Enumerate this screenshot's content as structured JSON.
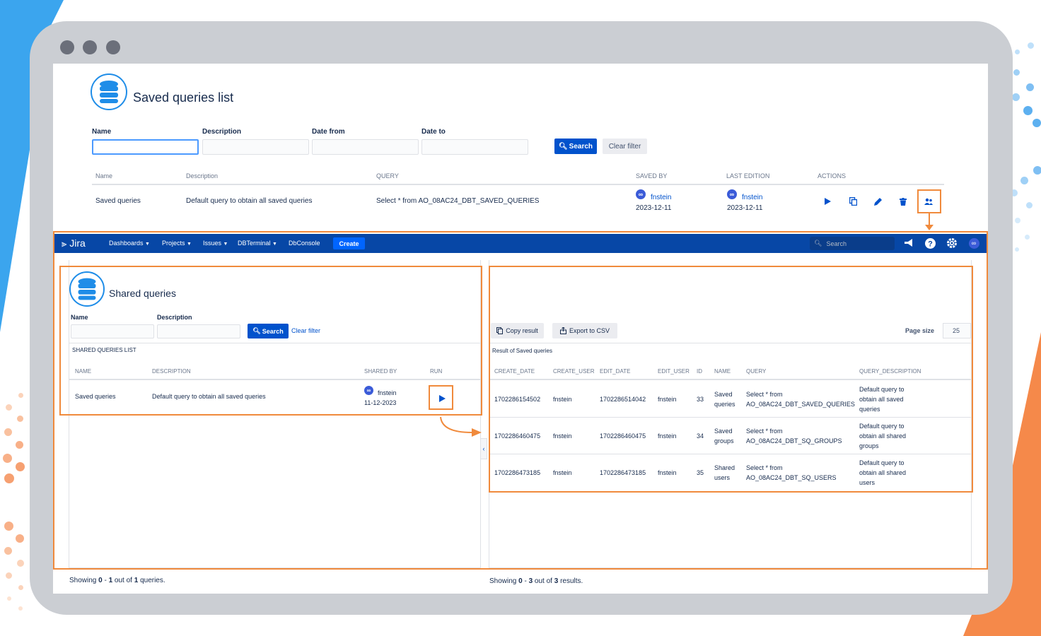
{
  "window": {
    "buttons": [
      "close",
      "minimize",
      "maximize"
    ]
  },
  "saved_list": {
    "title": "Saved queries list",
    "filters": {
      "name_label": "Name",
      "description_label": "Description",
      "date_from_label": "Date from",
      "date_to_label": "Date to",
      "search_button": "Search",
      "clear_button": "Clear filter"
    },
    "columns": [
      "Name",
      "Description",
      "QUERY",
      "SAVED BY",
      "LAST EDITION",
      "ACTIONS"
    ],
    "row": {
      "name": "Saved queries",
      "description": "Default query to obtain all saved queries",
      "query": "Select * from AO_08AC24_DBT_SAVED_QUERIES",
      "saved_by_user": "fnstein",
      "saved_by_date": "2023-12-11",
      "last_edition_user": "fnstein",
      "last_edition_date": "2023-12-11"
    }
  },
  "nav": {
    "logo": "Jira",
    "items": [
      "Dashboards",
      "Projects",
      "Issues",
      "DBTerminal",
      "DbConsole"
    ],
    "create": "Create",
    "search_placeholder": "Search"
  },
  "shared": {
    "title": "Shared queries",
    "name_label": "Name",
    "description_label": "Description",
    "search_button": "Search",
    "clear_link": "Clear filter",
    "list_title": "SHARED QUERIES LIST",
    "columns": [
      "NAME",
      "DESCRIPTION",
      "SHARED BY",
      "RUN"
    ],
    "row": {
      "name": "Saved queries",
      "description": "Default query to obtain all saved queries",
      "user": "fnstein",
      "date": "11-12-2023"
    },
    "footer_prefix": "Showing ",
    "footer_from": "0",
    "footer_dash": " - ",
    "footer_to": "1",
    "footer_mid": " out of ",
    "footer_total": "1",
    "footer_suffix": " queries."
  },
  "results": {
    "copy_button": "Copy result",
    "export_button": "Export to CSV",
    "page_size_label": "Page size",
    "page_size_value": "25",
    "result_title": "Result of Saved queries",
    "columns": [
      "CREATE_DATE",
      "CREATE_USER",
      "EDIT_DATE",
      "EDIT_USER",
      "ID",
      "NAME",
      "QUERY",
      "QUERY_DESCRIPTION"
    ],
    "rows": [
      {
        "create_date": "1702286154502",
        "create_user": "fnstein",
        "edit_date": "1702286514042",
        "edit_user": "fnstein",
        "id": "33",
        "name_l1": "Saved",
        "name_l2": "queries",
        "query_l1": "Select * from",
        "query_l2": "AO_08AC24_DBT_SAVED_QUERIES",
        "desc_l1": "Default query to",
        "desc_l2": "obtain all saved",
        "desc_l3": "queries"
      },
      {
        "create_date": "1702286460475",
        "create_user": "fnstein",
        "edit_date": "1702286460475",
        "edit_user": "fnstein",
        "id": "34",
        "name_l1": "Saved",
        "name_l2": "groups",
        "query_l1": "Select * from",
        "query_l2": "AO_08AC24_DBT_SQ_GROUPS",
        "desc_l1": "Default query to",
        "desc_l2": "obtain all shared",
        "desc_l3": "groups"
      },
      {
        "create_date": "1702286473185",
        "create_user": "fnstein",
        "edit_date": "1702286473185",
        "edit_user": "fnstein",
        "id": "35",
        "name_l1": "Shared",
        "name_l2": "users",
        "query_l1": "Select * from",
        "query_l2": "AO_08AC24_DBT_SQ_USERS",
        "desc_l1": "Default query to",
        "desc_l2": "obtain all shared",
        "desc_l3": "users"
      }
    ],
    "footer_prefix": "Showing ",
    "footer_from": "0",
    "footer_dash": " - ",
    "footer_to": "3",
    "footer_mid": " out of ",
    "footer_total": "3",
    "footer_suffix": " results."
  },
  "colors": {
    "accent": "#0052cc",
    "nav": "#0747a6",
    "highlight": "#f08a3c",
    "brand_blue": "#3ba5ee",
    "brand_orange": "#f5894a"
  },
  "icons": [
    "database-icon",
    "search-icon",
    "play-icon",
    "copy-icon",
    "edit-icon",
    "delete-icon",
    "share-users-icon",
    "megaphone-icon",
    "help-icon",
    "gear-icon",
    "avatar-icon",
    "export-icon",
    "chevron-left-icon"
  ]
}
